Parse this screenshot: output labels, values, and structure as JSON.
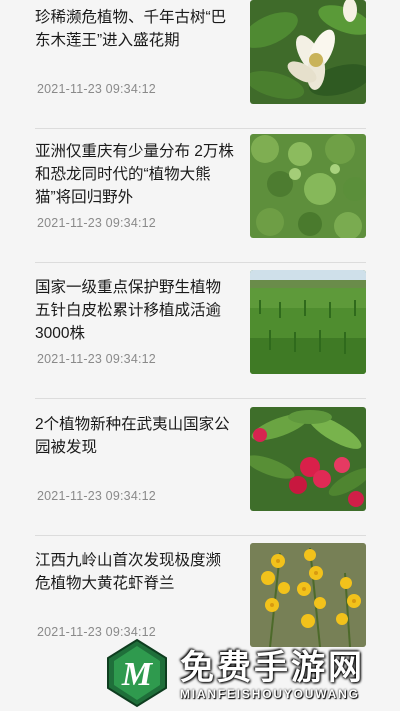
{
  "articles": [
    {
      "title": "珍稀濒危植物、千年古树“巴东木莲王”进入盛花期",
      "time": "2021-11-23 09:34:12",
      "thumb": "magnolia-flower-photo"
    },
    {
      "title": "亚洲仅重庆有少量分布 2万株和恐龙同时代的“植物大熊猫”将回归野外",
      "time": "2021-11-23 09:34:12",
      "thumb": "green-shrub-photo"
    },
    {
      "title": "国家一级重点保护野生植物五针白皮松累计移植成活逾3000株",
      "time": "2021-11-23 09:34:12",
      "thumb": "pine-nursery-photo"
    },
    {
      "title": "2个植物新种在武夷山国家公园被发现",
      "time": "2021-11-23 09:34:12",
      "thumb": "red-flower-photo"
    },
    {
      "title": "江西九岭山首次发现极度濒危植物大黄花虾脊兰",
      "time": "2021-11-23 09:34:12",
      "thumb": "yellow-orchid-photo"
    }
  ],
  "watermark": {
    "cn": "免费手游网",
    "en": "MIANFEISHOUYOUWANG",
    "logo": "mianfei-logo-icon"
  }
}
